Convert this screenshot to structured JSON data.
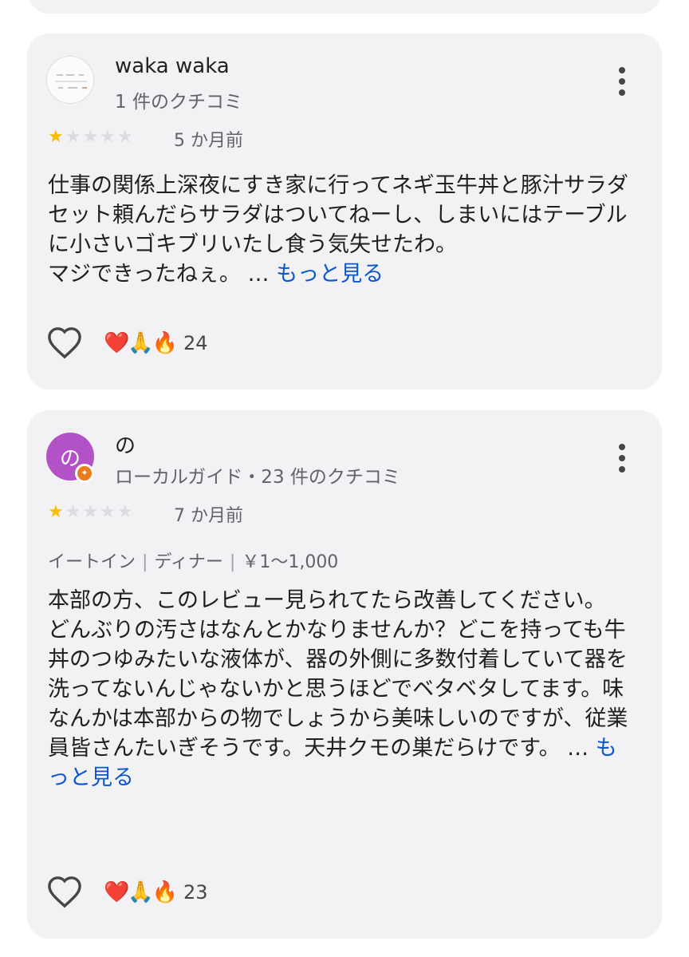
{
  "reviews": [
    {
      "author": "waka waka",
      "author_info": "1 件のクチコミ",
      "rating": 1,
      "max_rating": 5,
      "date": "5 か月前",
      "text": "仕事の関係上深夜にすき家に行ってネギ玉牛丼と豚汁サラダセット頼んだらサラダはついてねーし、しまいにはテーブルに小さいゴキブリいたし食う気失せたわ。\nマジできったねぇ。 …",
      "more_label": "もっと見る",
      "reactions": "❤️🙏🔥",
      "reaction_count": "24"
    },
    {
      "author": "の",
      "avatar_letter": "の",
      "author_info": "ローカルガイド・23 件のクチコミ",
      "rating": 1,
      "max_rating": 5,
      "date": "7 か月前",
      "tags": [
        "イートイン",
        "ディナー",
        "￥1～1,000"
      ],
      "text": "本部の方、このレビュー見られてたら改善してください。\nどんぶりの汚さはなんとかなりませんか？どこを持っても牛丼のつゆみたいな液体が、器の外側に多数付着していて器を洗ってないんじゃないかと思うほどでベタベタしてます。味なんかは本部からの物でしょうから美味しいのですが、従業員皆さんたいぎそうです。天井クモの巣だらけです。 …",
      "more_label": "もっと見る",
      "reactions": "❤️🙏🔥",
      "reaction_count": "23"
    }
  ],
  "colors": {
    "card_bg": "#f2f2f4",
    "star_on": "#fbbc04",
    "star_off": "#dadce0",
    "link": "#0b57d0",
    "avatar_purple": "#b351c7",
    "guide_badge": "#ea7b1a"
  },
  "icons": {
    "menu": "more-vert-icon",
    "like": "heart-outline-icon",
    "guide": "local-guide-badge-icon"
  }
}
